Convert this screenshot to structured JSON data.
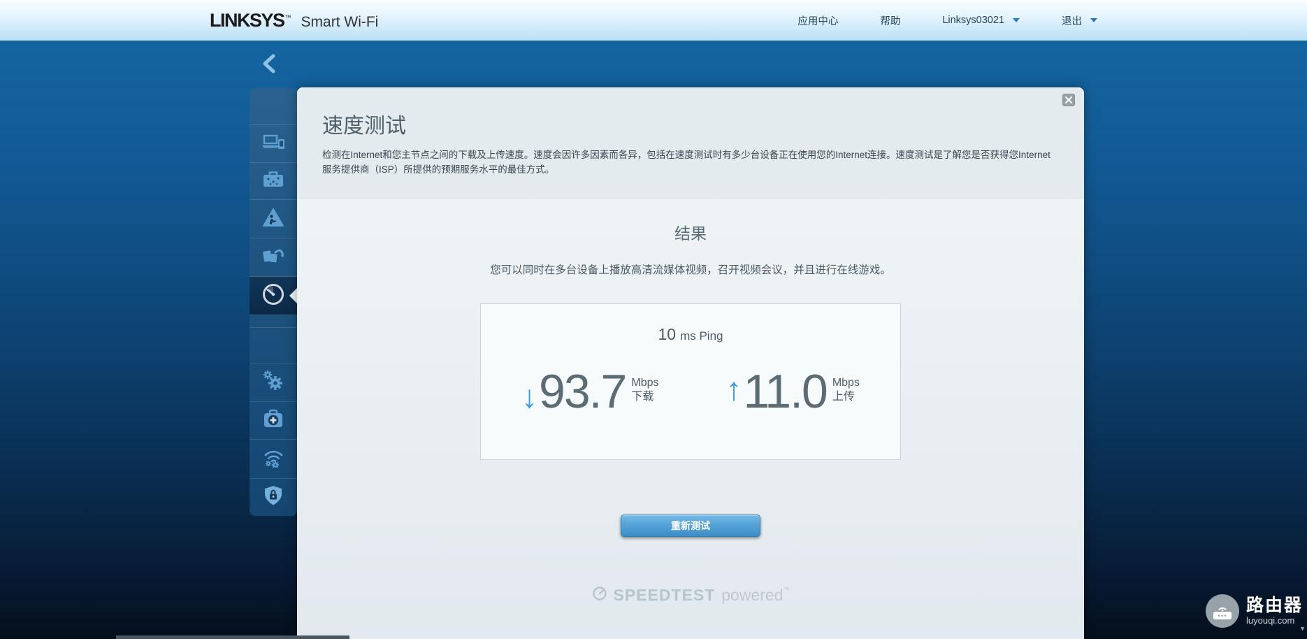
{
  "header": {
    "logo_primary": "LINKSYS",
    "logo_tm": "™",
    "logo_secondary": "Smart Wi-Fi",
    "nav": [
      {
        "label": "应用中心"
      },
      {
        "label": "帮助"
      },
      {
        "label": "Linksys03021",
        "has_dropdown": true
      },
      {
        "label": "退出",
        "has_dropdown": true
      }
    ]
  },
  "sidebar": {
    "items": [
      {
        "name": "network-map"
      },
      {
        "name": "guest-access"
      },
      {
        "name": "parental-controls"
      },
      {
        "name": "media-prioritization"
      },
      {
        "name": "speed-test",
        "active": true
      },
      {
        "name": "connectivity"
      },
      {
        "name": "troubleshooting"
      },
      {
        "name": "wireless"
      },
      {
        "name": "security"
      }
    ]
  },
  "main": {
    "title": "速度测试",
    "description": "检测在Internet和您主节点之间的下载及上传速度。速度会因许多因素而各异，包括在速度测试时有多少台设备正在使用您的Internet连接。速度测试是了解您是否获得您Internet服务提供商（ISP）所提供的预期服务水平的最佳方式。",
    "results_heading": "结果",
    "results_message": "您可以同时在多台设备上播放高清流媒体视频，召开视频会议，并且进行在线游戏。",
    "ping": {
      "value": "10",
      "unit": "ms Ping"
    },
    "download": {
      "value": "93.7",
      "unit": "Mbps",
      "label": "下载"
    },
    "upload": {
      "value": "11.0",
      "unit": "Mbps",
      "label": "上传"
    },
    "retest_button": "重新测试",
    "speedtest_brand": {
      "name": "SPEEDTEST",
      "powered": "powered",
      "tm": "™"
    }
  },
  "watermark": {
    "title": "路由器",
    "domain": "luyouqi.com"
  },
  "icons": {
    "download_arrow": "↓",
    "upload_arrow": "↑",
    "scroll_down_arrow": "▼"
  },
  "colors": {
    "accent_blue": "#3f9be0",
    "button_gradient_top": "#74bbe7",
    "button_gradient_bottom": "#3e8dc5",
    "header_gradient_bottom": "#b9e0f6",
    "panel_header_bg": "#e4ebef",
    "page_bg_top": "#1568a4",
    "page_bg_bottom": "#050f1c",
    "sidebar_icon": "#5f9fd2",
    "muted_brand": "#b6c4ce"
  }
}
